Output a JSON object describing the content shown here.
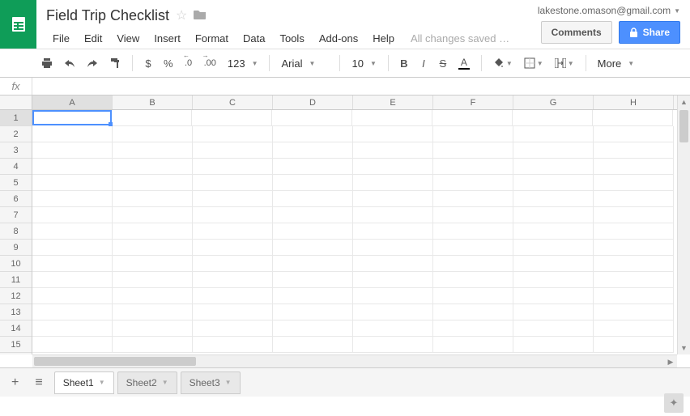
{
  "doc": {
    "title": "Field Trip Checklist",
    "save_status": "All changes saved …"
  },
  "account": {
    "email": "lakestone.omason@gmail.com"
  },
  "buttons": {
    "comments": "Comments",
    "share": "Share"
  },
  "menus": [
    "File",
    "Edit",
    "View",
    "Insert",
    "Format",
    "Data",
    "Tools",
    "Add-ons",
    "Help"
  ],
  "toolbar": {
    "currency": "$",
    "percent": "%",
    "dec_dec": ".0",
    "inc_dec": ".00",
    "num_fmt": "123",
    "font": "Arial",
    "size": "10",
    "more": "More"
  },
  "fx": {
    "label": "fx",
    "value": ""
  },
  "columns": [
    "A",
    "B",
    "C",
    "D",
    "E",
    "F",
    "G",
    "H"
  ],
  "rows": [
    "1",
    "2",
    "3",
    "4",
    "5",
    "6",
    "7",
    "8",
    "9",
    "10",
    "11",
    "12",
    "13",
    "14",
    "15"
  ],
  "active_cell": "A1",
  "sheets": [
    {
      "name": "Sheet1",
      "active": true
    },
    {
      "name": "Sheet2",
      "active": false
    },
    {
      "name": "Sheet3",
      "active": false
    }
  ]
}
